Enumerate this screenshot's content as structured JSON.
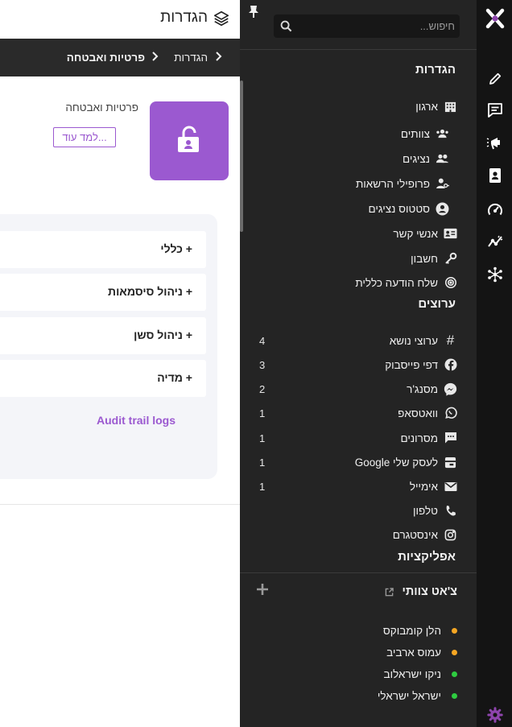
{
  "search": {
    "placeholder": "חיפוש..."
  },
  "settings_section": {
    "title": "הגדרות",
    "items": [
      {
        "label": "ארגון",
        "icon": "building-icon"
      },
      {
        "label": "צוותים",
        "icon": "teams-icon"
      },
      {
        "label": "נציגים",
        "icon": "agents-icon"
      },
      {
        "label": "פרופילי הרשאות",
        "icon": "user-key-icon"
      },
      {
        "label": "סטטוס נציגים",
        "icon": "agent-status-icon"
      },
      {
        "label": "אנשי קשר",
        "icon": "contact-card-icon"
      },
      {
        "label": "חשבון",
        "icon": "key-icon"
      },
      {
        "label": "שלח הודעה כללית",
        "icon": "broadcast-icon"
      }
    ]
  },
  "channels_section": {
    "title": "ערוצים",
    "items": [
      {
        "label": "ערוצי נושא",
        "count": "4",
        "icon": "hash-icon"
      },
      {
        "label": "דפי פייסבוק",
        "count": "3",
        "icon": "facebook-icon"
      },
      {
        "label": "מסנג'ר",
        "count": "2",
        "icon": "messenger-icon"
      },
      {
        "label": "וואטסאפ",
        "count": "1",
        "icon": "whatsapp-icon"
      },
      {
        "label": "מסרונים",
        "count": "1",
        "icon": "sms-icon"
      },
      {
        "label": "לעסק שלי Google",
        "count": "1",
        "icon": "google-business-icon"
      },
      {
        "label": "אימייל",
        "count": "1",
        "icon": "email-icon"
      },
      {
        "label": "טלפון",
        "count": "",
        "icon": "phone-icon"
      },
      {
        "label": "אינסטגרם",
        "count": "",
        "icon": "instagram-icon"
      }
    ]
  },
  "apps_section": {
    "title": "אפליקציות"
  },
  "team_chat": {
    "title": "צ'אט צוותי",
    "members": [
      {
        "name": "הלן קומבוקס",
        "status_color": "#f5a623"
      },
      {
        "name": "עמוס ארביב",
        "status_color": "#f5a623"
      },
      {
        "name": "ניקו ישראלוב",
        "status_color": "#2ecc40"
      },
      {
        "name": "ישראל ישראלי",
        "status_color": "#2ecc40"
      }
    ]
  },
  "header": {
    "title": "הגדרות"
  },
  "breadcrumb": {
    "root": "הגדרות",
    "current": "פרטיות ואבטחה"
  },
  "page": {
    "title": "פרטיות ואבטחה",
    "learn_more": "למד עוד...",
    "sections": [
      "+ כללי",
      "+ ניהול סיסמאות",
      "+ ניהול סשן",
      "+ מדיה"
    ],
    "audit_link": "Audit trail logs"
  },
  "colors": {
    "accent": "#9b59d0",
    "brand": "#8e44ad",
    "online": "#2ecc40",
    "away": "#f5a623"
  }
}
